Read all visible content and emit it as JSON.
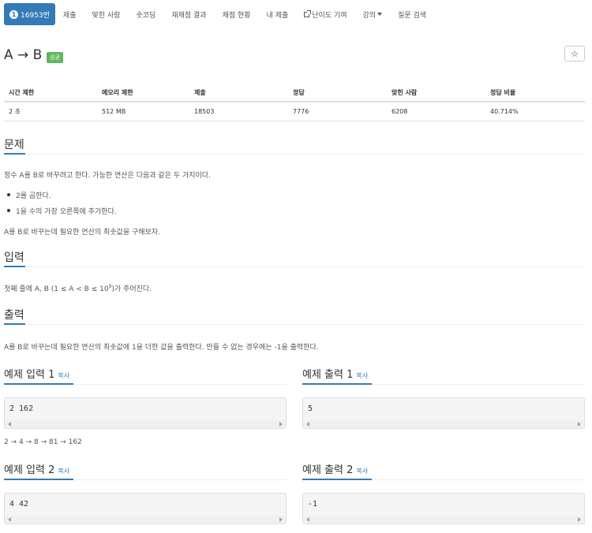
{
  "nav": {
    "problem_num": "16953번",
    "items": [
      "제출",
      "맞힌 사람",
      "숏코딩",
      "재채점 결과",
      "채점 현황",
      "내 제출",
      "난이도 기여",
      "강의",
      "질문 검색"
    ]
  },
  "problem": {
    "title": "A → B",
    "badge": "성공",
    "star": "☆"
  },
  "info": {
    "headers": [
      "시간 제한",
      "메모리 제한",
      "제출",
      "정답",
      "맞힌 사람",
      "정답 비율"
    ],
    "values": [
      "2 초",
      "512 MB",
      "18503",
      "7776",
      "6208",
      "40.714%"
    ]
  },
  "sections": {
    "problem_heading": "문제",
    "problem_text": "정수 A를 B로 바꾸려고 한다. 가능한 연산은 다음과 같은 두 가지이다.",
    "ops": [
      "2를 곱한다.",
      "1을 수의 가장 오른쪽에 추가한다."
    ],
    "problem_text2": "A를 B로 바꾸는데 필요한 연산의 최솟값을 구해보자.",
    "input_heading": "입력",
    "input_text_a": "첫째 줄에 A, B (1 ≤ A < B ≤ 10",
    "input_text_sup": "9",
    "input_text_b": ")가 주어진다.",
    "output_heading": "출력",
    "output_text": "A를 B로 바꾸는데 필요한 연산의 최솟값에 1을 더한 값을 출력한다. 만들 수 없는 경우에는 -1을 출력한다."
  },
  "examples": {
    "copy": "복사",
    "in1_title": "예제 입력 1",
    "out1_title": "예제 출력 1",
    "in1": "2 162",
    "out1": "5",
    "explanation": "2 → 4 → 8 → 81 → 162",
    "in2_title": "예제 입력 2",
    "out2_title": "예제 출력 2",
    "in2": "4 42",
    "out2": "-1"
  }
}
